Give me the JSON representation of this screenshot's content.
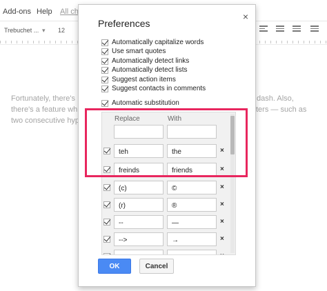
{
  "background": {
    "menu": [
      "Add-ons",
      "Help",
      "All cha"
    ],
    "toolbar": {
      "font": "Trebuchet ...",
      "font_size": "12"
    },
    "body_lines": [
      {
        "left": "Fortunately, there's",
        "right": "dash. Also,"
      },
      {
        "left": "there's a feature wh",
        "right": "ters — such as"
      },
      {
        "left": "two consecutive hyp",
        "right": ""
      }
    ]
  },
  "dialog": {
    "title": "Preferences",
    "close_glyph": "×",
    "options": [
      {
        "label": "Automatically capitalize words",
        "checked": true
      },
      {
        "label": "Use smart quotes",
        "checked": true
      },
      {
        "label": "Automatically detect links",
        "checked": true
      },
      {
        "label": "Automatically detect lists",
        "checked": true
      },
      {
        "label": "Suggest action items",
        "checked": true
      },
      {
        "label": "Suggest contacts in comments",
        "checked": true
      }
    ],
    "substitution": {
      "label": "Automatic substitution",
      "checked": true,
      "headers": {
        "replace": "Replace",
        "with": "With"
      },
      "rows": [
        {
          "replace": "",
          "with": "",
          "checked": false,
          "deletable": false
        },
        {
          "replace": "teh",
          "with": "the",
          "checked": true,
          "deletable": true
        },
        {
          "replace": "freinds",
          "with": "friends",
          "checked": true,
          "deletable": true
        },
        {
          "replace": "(c)",
          "with": "©",
          "checked": true,
          "deletable": true
        },
        {
          "replace": "(r)",
          "with": "®",
          "checked": true,
          "deletable": true
        },
        {
          "replace": "--",
          "with": "—",
          "checked": true,
          "deletable": true
        },
        {
          "replace": "-->",
          "with": "→",
          "checked": true,
          "deletable": true
        },
        {
          "replace": "",
          "with": "",
          "checked": true,
          "deletable": true
        }
      ],
      "delete_glyph": "×"
    },
    "buttons": {
      "ok": "OK",
      "cancel": "Cancel"
    },
    "highlight_color": "#e8265e",
    "primary_color": "#4a8af4"
  }
}
